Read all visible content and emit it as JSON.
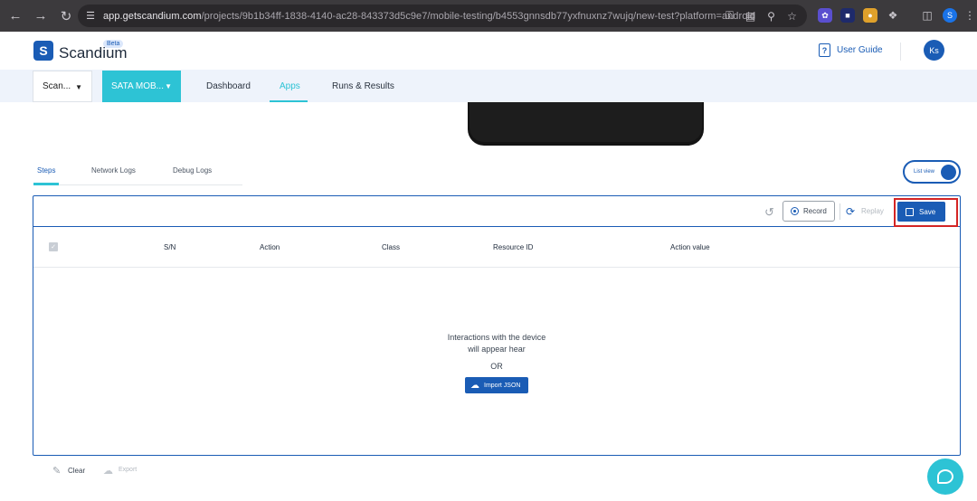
{
  "browser": {
    "url_host": "app.getscandium.com",
    "url_path": "/projects/9b1b34ff-1838-4140-ac28-843373d5c9e7/mobile-testing/b4553gnnsdb77yxfnuxnz7wujq/new-test?platform=android",
    "profile_initial": "S"
  },
  "header": {
    "brand": "Scandium",
    "brand_mark": "S",
    "beta_label": "Beta",
    "guide_label": "User Guide",
    "avatar_initials": "Ks"
  },
  "subnav": {
    "project_select": "Scan...",
    "app_select": "SATA MOB...",
    "tabs": [
      {
        "label": "Dashboard"
      },
      {
        "label": "Apps"
      },
      {
        "label": "Runs & Results"
      }
    ],
    "active_tab": "Apps"
  },
  "content_tabs": [
    {
      "label": "Steps"
    },
    {
      "label": "Network Logs"
    },
    {
      "label": "Debug Logs"
    }
  ],
  "view_toggle": {
    "label": "List view",
    "on": true
  },
  "toolbar": {
    "record_label": "Record",
    "replay_label": "Replay",
    "save_label": "Save"
  },
  "table": {
    "columns": [
      "S/N",
      "Action",
      "Class",
      "Resource ID",
      "Action value"
    ],
    "empty_line1": "Interactions with the device",
    "empty_line2": "will appear hear",
    "or_label": "OR",
    "import_label": "Import JSON"
  },
  "footer": {
    "clear_label": "Clear",
    "export_label": "Export"
  },
  "colors": {
    "primary": "#1a5cb5",
    "accent": "#2dc3d5",
    "highlight": "#d42525"
  }
}
